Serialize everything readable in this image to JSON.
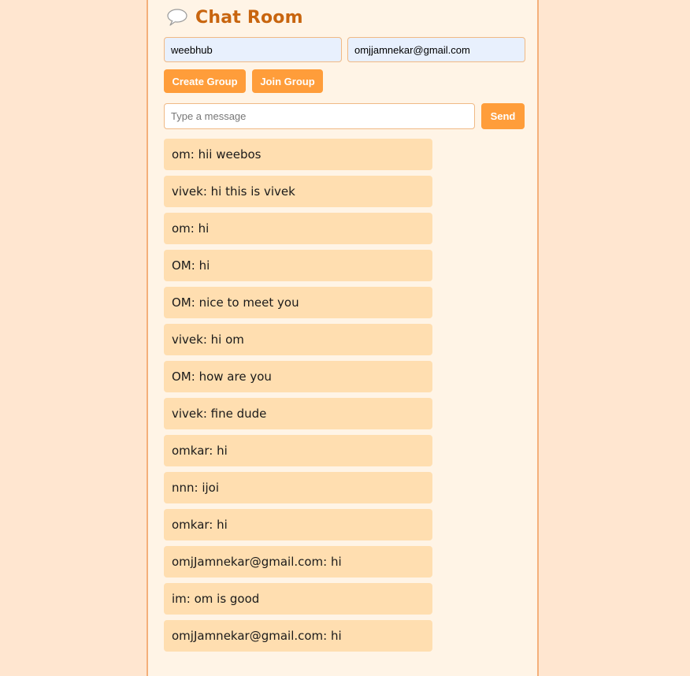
{
  "header": {
    "title": "Chat Room"
  },
  "form": {
    "group_name_value": "weebhub",
    "email_value": "omjjamnekar@gmail.com",
    "create_label": "Create Group",
    "join_label": "Join Group",
    "message_placeholder": "Type a message",
    "send_label": "Send"
  },
  "messages": [
    "om: hii weebos",
    "vivek: hi this is vivek",
    "om: hi",
    "OM: hi",
    "OM: nice to meet you",
    "vivek: hi om",
    "OM: how are you",
    "vivek: fine dude",
    "omkar: hi",
    "nnn: ijoi",
    "omkar: hi",
    "omjJamnekar@gmail.com: hi",
    "im: om is good",
    "omjJamnekar@gmail.com: hi"
  ],
  "colors": {
    "page_background": "#ffe6d0",
    "panel_background": "#fff4e6",
    "accent": "#ff9d3a",
    "title": "#c8650f",
    "message_background": "#ffdeb0"
  },
  "icons": {
    "header_icon": "speech-bubble-icon"
  }
}
